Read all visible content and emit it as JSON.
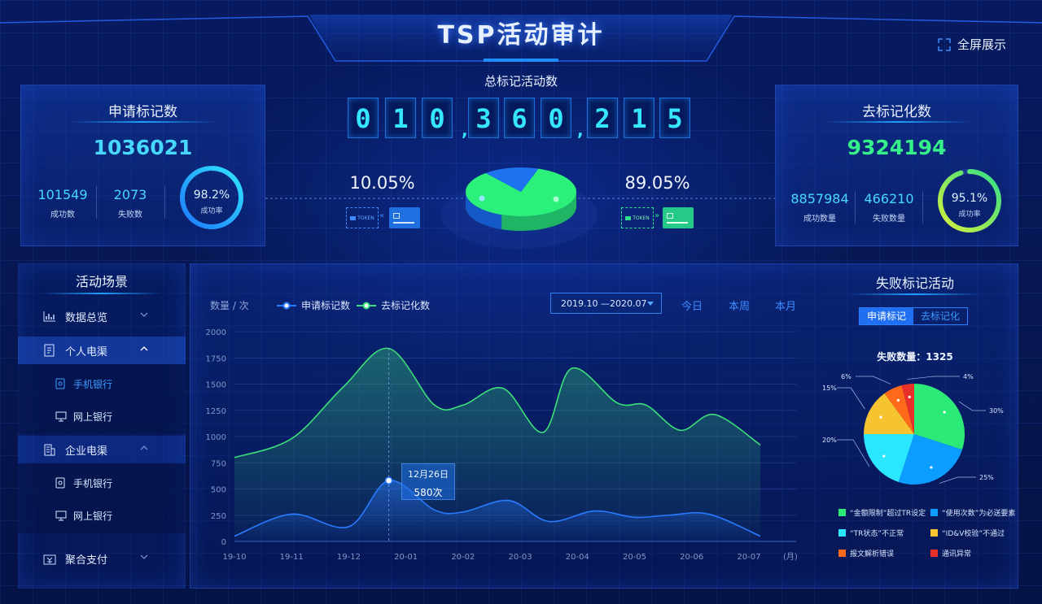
{
  "header": {
    "title": "TSP活动审计",
    "fullscreen_label": "全屏展示"
  },
  "apply_panel": {
    "title": "申请标记数",
    "total": "1036021",
    "success": {
      "value": "101549",
      "label": "成功数"
    },
    "fail": {
      "value": "2073",
      "label": "失败数"
    },
    "rate": {
      "value": "98.2%",
      "label": "成功率",
      "fraction": 0.982
    }
  },
  "center": {
    "title": "总标记活动数",
    "digits": [
      "0",
      "1",
      "0",
      "3",
      "6",
      "0",
      "2",
      "1",
      "5"
    ],
    "comma": ",",
    "left_pct": "10.05%",
    "right_pct": "89.05%",
    "token_label": "TOKEN",
    "pie_share": 0.1005
  },
  "detoken_panel": {
    "title": "去标记化数",
    "total": "9324194",
    "success": {
      "value": "8857984",
      "label": "成功数量"
    },
    "fail": {
      "value": "466210",
      "label": "失败数量"
    },
    "rate": {
      "value": "95.1%",
      "label": "成功率",
      "fraction": 0.951
    }
  },
  "sidebar": {
    "title": "活动场景",
    "items": [
      {
        "label": "数据总览"
      },
      {
        "label": "个人电渠",
        "children": [
          {
            "label": "手机银行"
          },
          {
            "label": "网上银行"
          }
        ]
      },
      {
        "label": "企业电渠",
        "children": [
          {
            "label": "手机银行"
          },
          {
            "label": "网上银行"
          }
        ]
      },
      {
        "label": "聚合支付"
      }
    ]
  },
  "chart_controls": {
    "unit_label": "数量 / 次",
    "date_range": "2019.10 —2020.07",
    "buttons": [
      "今日",
      "本周",
      "本月"
    ]
  },
  "tooltip": {
    "date": "12月26日",
    "value": "580次"
  },
  "chart_data": [
    {
      "type": "line",
      "x": [
        "19-10",
        "19-11",
        "19-12",
        "20-01",
        "20-02",
        "20-03",
        "20-04",
        "20-05",
        "20-06",
        "20-07"
      ],
      "x_unit": "(月)",
      "ylim": [
        0,
        2000
      ],
      "yticks": [
        0,
        250,
        500,
        750,
        1000,
        1250,
        1500,
        1750,
        2000
      ],
      "ylabel": "数量 / 次",
      "grid": true,
      "legend": "top-left",
      "series": [
        {
          "name": "申请标记数",
          "color": "#2a7bff",
          "points": [
            [
              0,
              50
            ],
            [
              1,
              260
            ],
            [
              2,
              140
            ],
            [
              2.7,
              580
            ],
            [
              3.5,
              300
            ],
            [
              4,
              280
            ],
            [
              4.8,
              390
            ],
            [
              5.5,
              190
            ],
            [
              6.3,
              290
            ],
            [
              7,
              230
            ],
            [
              7.6,
              250
            ],
            [
              8.3,
              260
            ],
            [
              9.2,
              50
            ]
          ]
        },
        {
          "name": "去标记化数",
          "color": "#3ce07a",
          "points": [
            [
              0,
              800
            ],
            [
              1,
              980
            ],
            [
              1.9,
              1470
            ],
            [
              2.7,
              1840
            ],
            [
              3.5,
              1300
            ],
            [
              4,
              1300
            ],
            [
              4.7,
              1460
            ],
            [
              5.4,
              1040
            ],
            [
              5.9,
              1650
            ],
            [
              6.7,
              1320
            ],
            [
              7.2,
              1300
            ],
            [
              7.8,
              1060
            ],
            [
              8.4,
              1210
            ],
            [
              9.2,
              920
            ]
          ]
        }
      ]
    },
    {
      "type": "pie",
      "title": "失败标记活动",
      "subtitle": "失败数量：1325",
      "categories": [
        "“金额限制”超过TR设定",
        "“使用次数”为必送要素",
        "“TR状态”不正常",
        "“ID&V校验”不通过",
        "报文解析错误",
        "通讯异常"
      ],
      "slices": [
        {
          "label": "30%",
          "value": 30,
          "color": "#2bea77"
        },
        {
          "label": "25%",
          "value": 25,
          "color": "#0b9dff"
        },
        {
          "label": "20%",
          "value": 20,
          "color": "#2ae6ff"
        },
        {
          "label": "15%",
          "value": 15,
          "color": "#f5c430"
        },
        {
          "label": "6%",
          "value": 6,
          "color": "#ff6a1a"
        },
        {
          "label": "4%",
          "value": 4,
          "color": "#e8302a"
        }
      ],
      "tabs": [
        "申请标记",
        "去标记化"
      ]
    }
  ],
  "colors": {
    "accent": "#1fa0ff",
    "green": "#2bea77",
    "cyan": "#35e6ff"
  }
}
